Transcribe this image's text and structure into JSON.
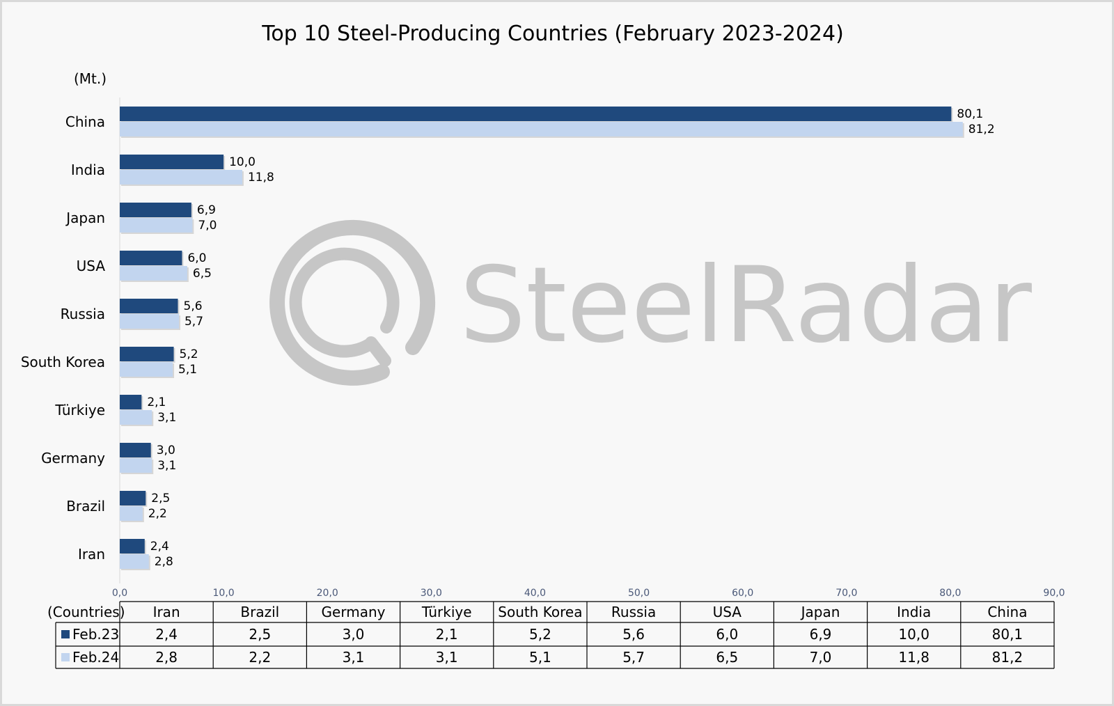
{
  "chart_data": {
    "type": "bar",
    "orientation": "horizontal",
    "title": "Top 10 Steel-Producing Countries (February 2023-2024)",
    "unit_label": "(Mt.)",
    "categories": [
      "China",
      "India",
      "Japan",
      "USA",
      "Russia",
      "South Korea",
      "Türkiye",
      "Germany",
      "Brazil",
      "Iran"
    ],
    "series": [
      {
        "name": "Feb.23",
        "color": "#1f497d",
        "values": [
          80.1,
          10.0,
          6.9,
          6.0,
          5.6,
          5.2,
          2.1,
          3.0,
          2.5,
          2.4
        ],
        "labels": [
          "80,1",
          "10,0",
          "6,9",
          "6,0",
          "5,6",
          "5,2",
          "2,1",
          "3,0",
          "2,5",
          "2,4"
        ]
      },
      {
        "name": "Feb.24",
        "color": "#c2d5ef",
        "values": [
          81.2,
          11.8,
          7.0,
          6.5,
          5.7,
          5.1,
          3.1,
          3.1,
          2.2,
          2.8
        ],
        "labels": [
          "81,2",
          "11,8",
          "7,0",
          "6,5",
          "5,7",
          "5,1",
          "3,1",
          "3,1",
          "2,2",
          "2,8"
        ]
      }
    ],
    "xlim": [
      0,
      90
    ],
    "xticks": [
      "0,0",
      "10,0",
      "20,0",
      "30,0",
      "40,0",
      "50,0",
      "60,0",
      "70,0",
      "80,0",
      "90,0"
    ],
    "grid": false,
    "data_table": {
      "header_label": "(Countries)",
      "columns": [
        "Iran",
        "Brazil",
        "Germany",
        "Türkiye",
        "South Korea",
        "Russia",
        "USA",
        "Japan",
        "India",
        "China"
      ],
      "rows": [
        {
          "name": "Feb.23",
          "values": [
            "2,4",
            "2,5",
            "3,0",
            "2,1",
            "5,2",
            "5,6",
            "6,0",
            "6,9",
            "10,0",
            "80,1"
          ]
        },
        {
          "name": "Feb.24",
          "values": [
            "2,8",
            "2,2",
            "3,1",
            "3,1",
            "5,1",
            "5,7",
            "6,5",
            "7,0",
            "11,8",
            "81,2"
          ]
        }
      ]
    }
  },
  "watermark": {
    "text": "SteelRadar",
    "color": "#c4c4c4"
  }
}
